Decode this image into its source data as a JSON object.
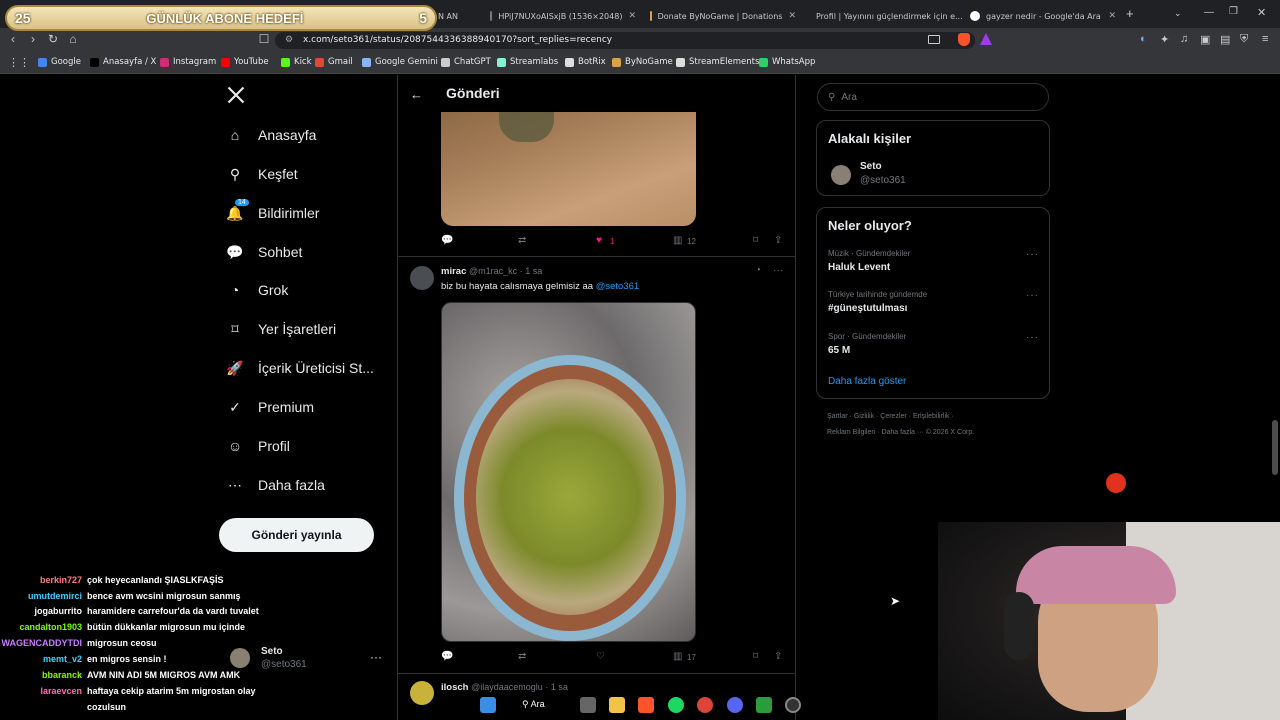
{
  "overlay": {
    "goal_start": "25",
    "goal_title": "GÜNLÜK ABONE HEDEFİ",
    "goal_end": "5"
  },
  "browser": {
    "tabs": [
      {
        "label": "N AN",
        "color": "#555"
      },
      {
        "label": "HPiJ7NUXoAISxjB (1536×2048)",
        "color": "#000"
      },
      {
        "label": "Donate ByNoGame | Donations",
        "color": "#d9a441"
      },
      {
        "label": "Profil | Yayınını güçlendirmek için e...",
        "color": "#d9a441"
      },
      {
        "label": "gayzer nedir - Google'da Ara",
        "color": "#4285f4"
      }
    ],
    "url": "x.com/seto361/status/2087544336388940170?sort_replies=recency",
    "bookmarks": [
      {
        "label": "Google",
        "color": "#4285f4"
      },
      {
        "label": "Anasayfa / X",
        "color": "#000"
      },
      {
        "label": "Instagram",
        "color": "#d62976"
      },
      {
        "label": "YouTube",
        "color": "#ff0000"
      },
      {
        "label": "Kick",
        "color": "#53fc18"
      },
      {
        "label": "Gmail",
        "color": "#ea4335"
      },
      {
        "label": "Google Gemini",
        "color": "#8ab4f8"
      },
      {
        "label": "ChatGPT",
        "color": "#ccc"
      },
      {
        "label": "Streamlabs",
        "color": "#80f5d2"
      },
      {
        "label": "BotRix",
        "color": "#ddd"
      },
      {
        "label": "ByNoGame",
        "color": "#d9a441"
      },
      {
        "label": "StreamElements",
        "color": "#ddd"
      },
      {
        "label": "WhatsApp",
        "color": "#25d366"
      }
    ]
  },
  "sidebar": {
    "items": [
      {
        "label": "Anasayfa"
      },
      {
        "label": "Keşfet"
      },
      {
        "label": "Bildirimler",
        "badge": "14"
      },
      {
        "label": "Sohbet"
      },
      {
        "label": "Grok"
      },
      {
        "label": "Yer İşaretleri"
      },
      {
        "label": "İçerik Üreticisi St..."
      },
      {
        "label": "Premium"
      },
      {
        "label": "Profil"
      },
      {
        "label": "Daha fazla"
      }
    ],
    "post_button": "Gönderi yayınla",
    "account": {
      "name": "Seto",
      "handle": "@seto361"
    }
  },
  "main": {
    "header_title": "Gönderi",
    "first_post": {
      "likes": "1",
      "views": "12"
    },
    "reply": {
      "name": "mirac",
      "handle": "@m1rac_kc",
      "time": "· 1 sa",
      "text": "biz bu hayata calısmaya gelmisiz aa",
      "mention": "@seto361",
      "views": "17"
    },
    "next_reply": {
      "name": "ilosch",
      "handle": "@ilaydaacemoglu",
      "time": "· 1 sa"
    }
  },
  "right": {
    "search_placeholder": "Ara",
    "related_title": "Alakalı kişiler",
    "related_person": {
      "name": "Seto",
      "handle": "@seto361"
    },
    "trends_title": "Neler oluyor?",
    "trends": [
      {
        "meta": "Müzik · Gündemdekiler",
        "name": "Haluk Levent"
      },
      {
        "meta": "Türkiye tarihinde gündemde",
        "name": "#güneştutulması"
      },
      {
        "meta": "Spor · Gündemdekiler",
        "name": "65 M"
      }
    ],
    "show_more": "Daha fazla göster",
    "footer_line1": "Şartlar · Gizlilik · Çerezler · Erişilebilirlik ·",
    "footer_line2": "Reklam Bilgileri · Daha fazla ··· © 2026 X Corp."
  },
  "chat": [
    {
      "user": "berkin727",
      "color": "#ff7f7f",
      "msg": "çok heyecanlandı ŞIASLKFAŞİS"
    },
    {
      "user": "umutdemirci",
      "color": "#3ed0ff",
      "msg": "bence avm wcsini migrosun sanmış"
    },
    {
      "user": "jogaburrito",
      "color": "#ffffff",
      "msg": "haramidere carrefour'da da vardı tuvalet"
    },
    {
      "user": "candalton1903",
      "color": "#7cfc00",
      "msg": "bütün dükkanlar migrosun mu içinde"
    },
    {
      "user": "WAGENCADDYTDI",
      "color": "#c77dff",
      "msg": "migrosun ceosu"
    },
    {
      "user": "memt_v2",
      "color": "#3ed0ff",
      "msg": "en migros sensin !"
    },
    {
      "user": "bbaranck",
      "color": "#7cfc00",
      "msg": "AVM NIN ADI 5M MIGROS AVM AMK"
    },
    {
      "user": "laraevcen",
      "color": "#ff69b4",
      "msg": "haftaya cekip atarim 5m migrostan olay"
    },
    {
      "user": "",
      "color": "#ffffff",
      "msg": "cozulsun"
    }
  ],
  "taskbar": {
    "search_label": "Ara"
  }
}
